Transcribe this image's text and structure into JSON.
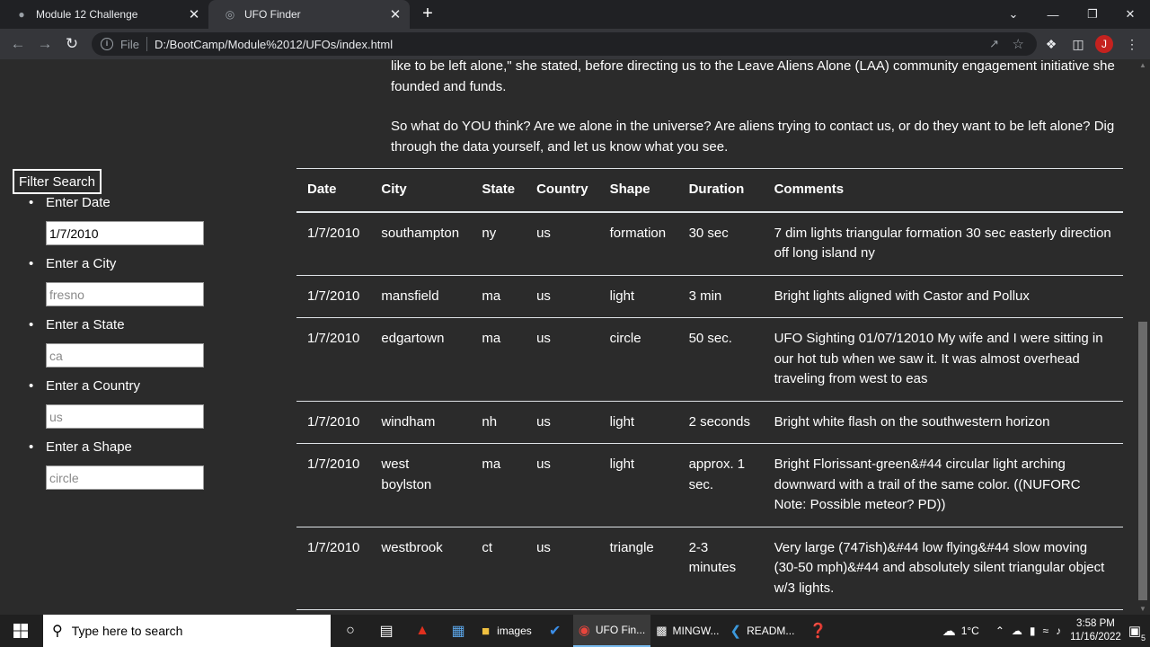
{
  "browser": {
    "tabs": [
      {
        "title": "Module 12 Challenge",
        "active": false
      },
      {
        "title": "UFO Finder",
        "active": true
      }
    ],
    "address": {
      "scheme": "File",
      "url": "D:/BootCamp/Module%2012/UFOs/index.html"
    },
    "profile_initial": "J",
    "accent": "#c5221f"
  },
  "article": {
    "paragraphs": [
      "like to be left alone,\" she stated, before directing us to the Leave Aliens Alone (LAA) community engagement initiative she founded and funds.",
      "So what do YOU think? Are we alone in the universe? Are aliens trying to contact us, or do they want to be left alone? Dig through the data yourself, and let us know what you see."
    ]
  },
  "filters": {
    "button_label": "Filter Search",
    "fields": [
      {
        "label": "Enter Date",
        "value": "1/7/2010",
        "placeholder": ""
      },
      {
        "label": "Enter a City",
        "value": "",
        "placeholder": "fresno"
      },
      {
        "label": "Enter a State",
        "value": "",
        "placeholder": "ca"
      },
      {
        "label": "Enter a Country",
        "value": "",
        "placeholder": "us"
      },
      {
        "label": "Enter a Shape",
        "value": "",
        "placeholder": "circle"
      }
    ]
  },
  "table": {
    "headers": [
      "Date",
      "City",
      "State",
      "Country",
      "Shape",
      "Duration",
      "Comments"
    ],
    "rows": [
      [
        "1/7/2010",
        "southampton",
        "ny",
        "us",
        "formation",
        "30 sec",
        "7 dim lights triangular formation 30 sec easterly direction off long island ny"
      ],
      [
        "1/7/2010",
        "mansfield",
        "ma",
        "us",
        "light",
        "3 min",
        "Bright lights aligned with Castor and Pollux"
      ],
      [
        "1/7/2010",
        "edgartown",
        "ma",
        "us",
        "circle",
        "50 sec.",
        "UFO Sighting 01/07/12010 My wife and I were sitting in our hot tub when we saw it. It was almost overhead traveling from west to eas"
      ],
      [
        "1/7/2010",
        "windham",
        "nh",
        "us",
        "light",
        "2 seconds",
        "Bright white flash on the southwestern horizon"
      ],
      [
        "1/7/2010",
        "west boylston",
        "ma",
        "us",
        "light",
        "approx. 1 sec.",
        "Bright Florissant-green&#44 circular light arching downward with a trail of the same color. ((NUFORC Note: Possible meteor? PD))"
      ],
      [
        "1/7/2010",
        "westbrook",
        "ct",
        "us",
        "triangle",
        "2-3 minutes",
        "Very large (747ish)&#44 low flying&#44 slow moving (30-50 mph)&#44 and absolutely silent triangular object w/3 lights."
      ]
    ]
  },
  "taskbar": {
    "search_placeholder": "Type here to search",
    "apps": [
      {
        "label": "images",
        "icon": "folder-icon"
      },
      {
        "label": "UFO Fin...",
        "icon": "chrome-icon",
        "active": true
      },
      {
        "label": "MINGW...",
        "icon": "terminal-icon"
      },
      {
        "label": "READM...",
        "icon": "vscode-icon"
      }
    ],
    "weather": "1°C",
    "time": "3:58 PM",
    "date": "11/16/2022",
    "notifications": "5"
  }
}
